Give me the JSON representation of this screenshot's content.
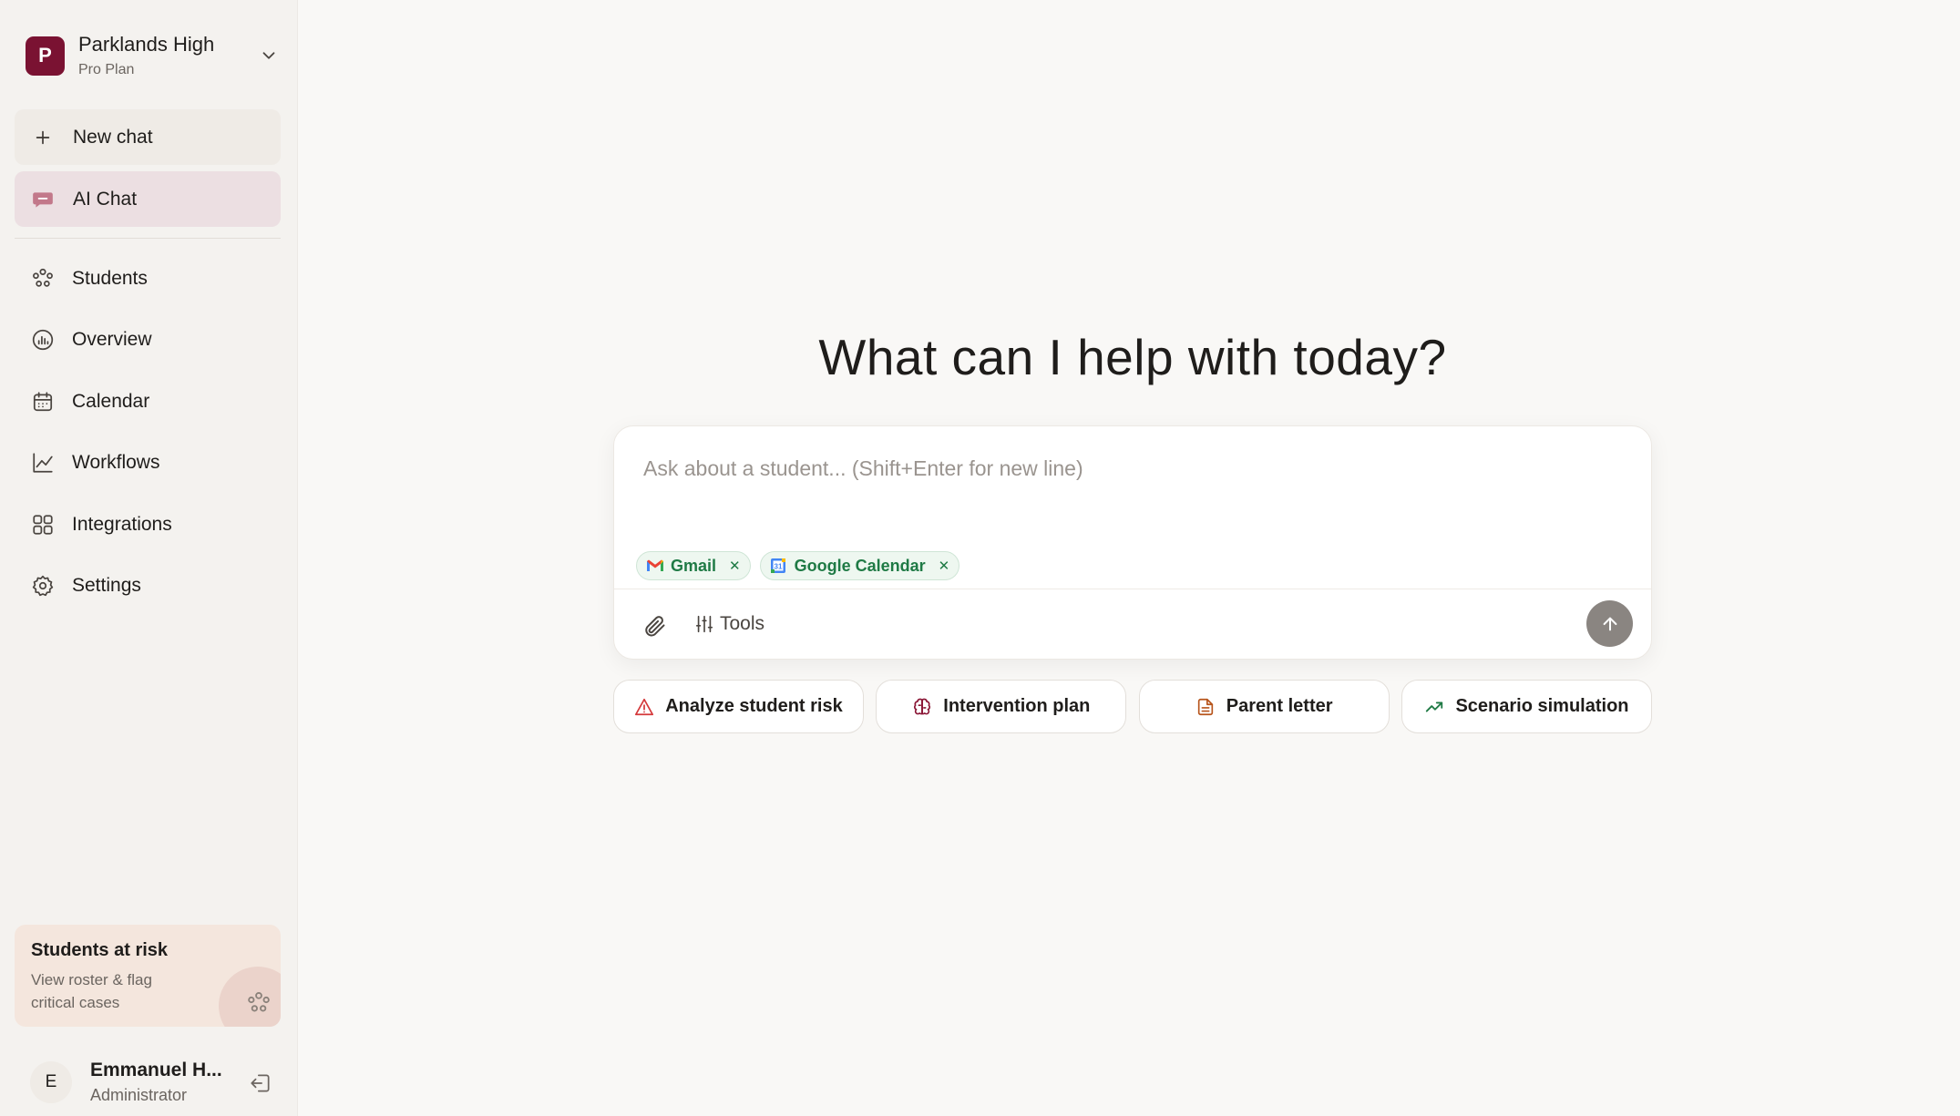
{
  "workspace": {
    "initial": "P",
    "name": "Parklands High",
    "plan": "Pro Plan",
    "brand_color": "#7a1232"
  },
  "sidebar": {
    "new_chat": "New chat",
    "ai_chat": "AI Chat",
    "items": [
      {
        "label": "Students",
        "icon": "students-icon"
      },
      {
        "label": "Overview",
        "icon": "overview-icon"
      },
      {
        "label": "Calendar",
        "icon": "calendar-icon"
      },
      {
        "label": "Workflows",
        "icon": "workflows-icon"
      },
      {
        "label": "Integrations",
        "icon": "integrations-icon"
      },
      {
        "label": "Settings",
        "icon": "settings-icon"
      }
    ],
    "risk_card": {
      "title": "Students at risk",
      "subtitle": "View roster & flag critical cases"
    },
    "user": {
      "initial": "E",
      "name": "Emmanuel H...",
      "role": "Administrator"
    }
  },
  "main": {
    "headline": "What can I help with today?",
    "composer": {
      "placeholder": "Ask about a student... (Shift+Enter for new line)",
      "chips": [
        {
          "label": "Gmail",
          "icon": "gmail-icon"
        },
        {
          "label": "Google Calendar",
          "icon": "google-calendar-icon"
        }
      ],
      "tools_label": "Tools"
    },
    "quick_actions": [
      {
        "label": "Analyze student risk",
        "icon": "warning-icon",
        "color": "#d4383a"
      },
      {
        "label": "Intervention plan",
        "icon": "brain-icon",
        "color": "#8a1535"
      },
      {
        "label": "Parent letter",
        "icon": "document-icon",
        "color": "#b7541b"
      },
      {
        "label": "Scenario simulation",
        "icon": "trending-up-icon",
        "color": "#1f7a45"
      }
    ]
  }
}
